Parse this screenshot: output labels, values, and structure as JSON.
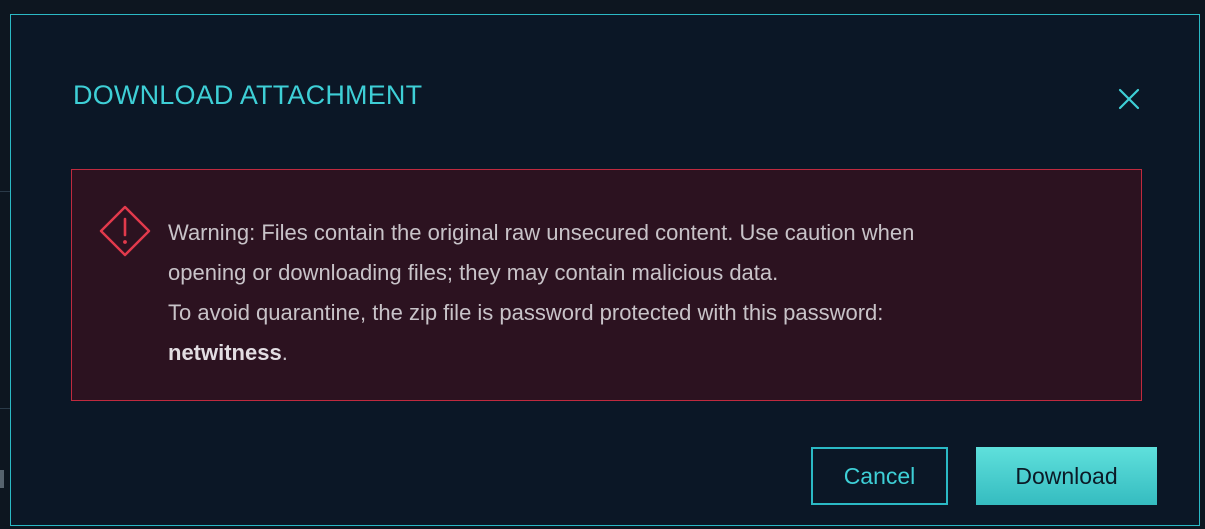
{
  "dialog": {
    "title": "DOWNLOAD ATTACHMENT",
    "close_icon": "close-icon",
    "accent_color": "#3ecfd6"
  },
  "warning": {
    "icon": "warning-diamond-icon",
    "line1": "Warning: Files contain the original raw unsecured content. Use caution when",
    "line2": "opening or downloading files; they may contain malicious data.",
    "line3": "To avoid quarantine, the zip file is password protected with this password:",
    "password": "netwitness",
    "password_suffix": ".",
    "border_color": "#c02a3e",
    "background_color": "#2c1220"
  },
  "buttons": {
    "cancel_label": "Cancel",
    "download_label": "Download"
  }
}
